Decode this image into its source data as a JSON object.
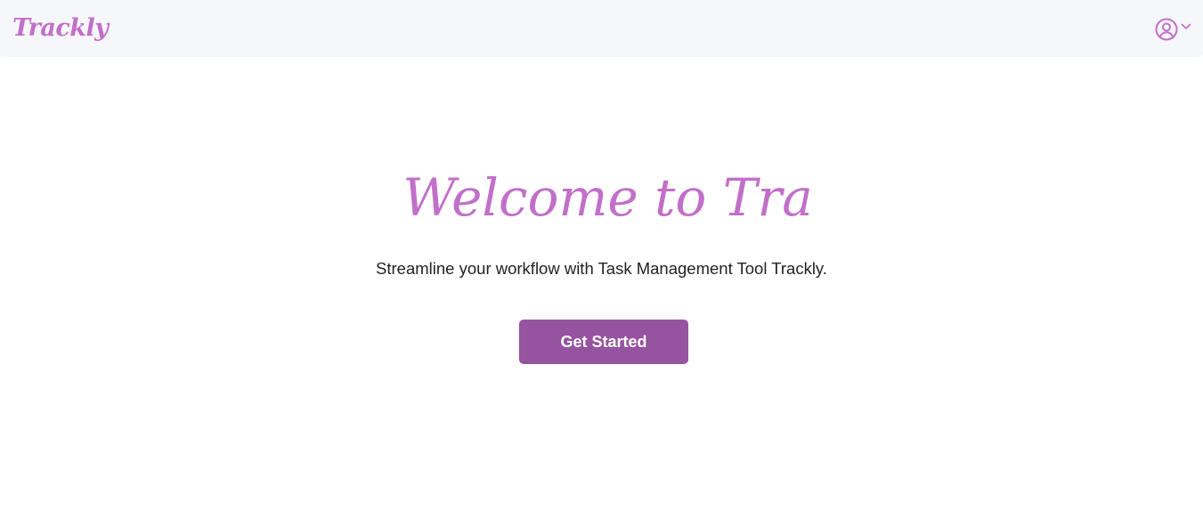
{
  "navbar": {
    "brand": "Trackly",
    "user_menu": {
      "avatar_icon": "user-circle-icon",
      "dropdown_icon": "chevron-down-icon"
    }
  },
  "hero": {
    "title": "Welcome to Tra",
    "subtitle": "Streamline your workflow with Task Management Tool Trackly.",
    "cta_label": "Get Started"
  },
  "colors": {
    "brand": "#c16fc9",
    "button": "#9553a0",
    "navbar_bg": "#f6f7fa",
    "text": "#222222"
  }
}
